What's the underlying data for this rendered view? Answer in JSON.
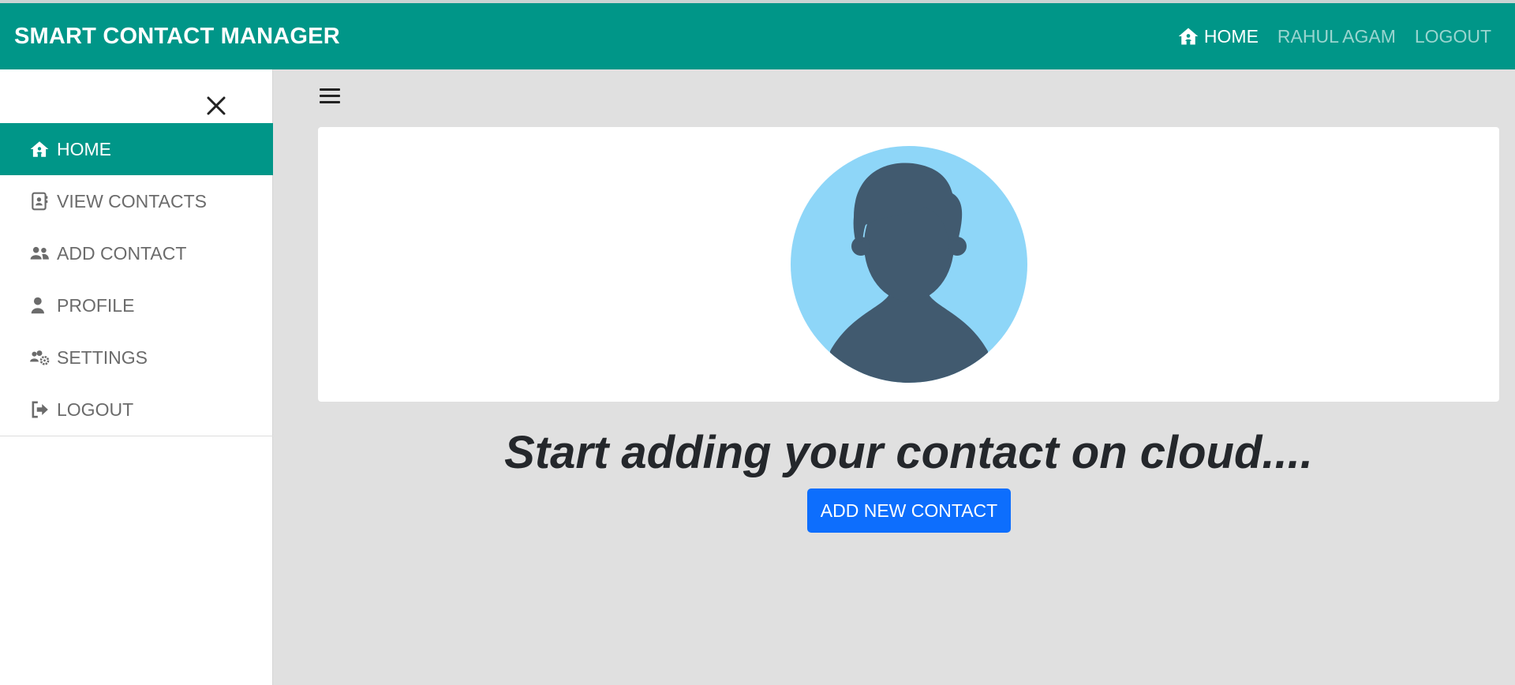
{
  "navbar": {
    "brand": "SMART CONTACT MANAGER",
    "links": [
      {
        "label": "HOME",
        "icon": "house-icon",
        "active": true
      },
      {
        "label": "RAHUL AGAM"
      },
      {
        "label": "LOGOUT"
      }
    ]
  },
  "sidebar": {
    "close_icon": "close-icon",
    "items": [
      {
        "label": "HOME",
        "icon": "house-icon",
        "active": true
      },
      {
        "label": "VIEW CONTACTS",
        "icon": "address-book-icon"
      },
      {
        "label": "ADD CONTACT",
        "icon": "users-icon"
      },
      {
        "label": "PROFILE",
        "icon": "user-icon"
      },
      {
        "label": "SETTINGS",
        "icon": "users-gear-icon"
      },
      {
        "label": "LOGOUT",
        "icon": "sign-out-icon"
      }
    ]
  },
  "main": {
    "hamburger_icon": "hamburger-icon",
    "avatar_icon": "user-avatar-icon",
    "headline": "Start adding your contact on cloud....",
    "add_button": "ADD NEW CONTACT"
  },
  "colors": {
    "primary": "#009688",
    "button": "#0d6efd",
    "background": "#e0e0e0",
    "avatar_bg": "#8ed6f8",
    "avatar_fg": "#415a6f"
  }
}
